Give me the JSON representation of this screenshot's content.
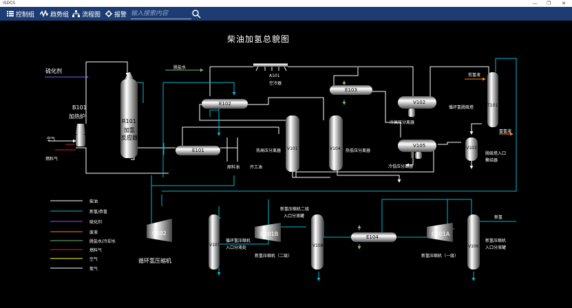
{
  "window": {
    "app_name": "iSDCS",
    "minimize": "—",
    "maximize": "❐",
    "close": "✕"
  },
  "toolbar": {
    "items": [
      {
        "label": "控制组",
        "icon": "list-icon"
      },
      {
        "label": "趋势组",
        "icon": "trend-icon"
      },
      {
        "label": "流程图",
        "icon": "flowchart-icon"
      },
      {
        "label": "报警",
        "icon": "alarm-gear-icon"
      }
    ],
    "search_placeholder": "输入搜索内容"
  },
  "page_title": "柴油加氢总貌图",
  "colors": {
    "toolbar": "#1d3c71",
    "diesel": "#ffffff",
    "hydrogen": "#00bcd4",
    "sulfide": "#8a5cf6",
    "waste_hydrogen": "#ff8800",
    "desalted_water": "#70c070",
    "fuel_gas": "#e02020",
    "air": "#ffff33",
    "nitrogen": "#ffffff"
  },
  "labels": {
    "sulfide_agent": "硫化剂",
    "b101_code": "B101",
    "b101_name": "加热炉",
    "air": "空气",
    "fuel_gas": "燃料气",
    "desalted_water": "脱盐水",
    "a101_code": "A101",
    "a101_name": "空冷器",
    "r101_code": "R101",
    "r101_name1": "加氢",
    "r101_name2": "反应器",
    "e102": "E102",
    "e101": "E101",
    "e103": "E103",
    "e104": "E104",
    "v101": "V101",
    "v104": "V104",
    "v102": "V102",
    "v105": "V105",
    "v103": "V103",
    "v107": "V107",
    "v108": "V108",
    "v106": "V106",
    "t101": "T101",
    "c102": "C102",
    "c101b": "C101B",
    "c101a": "C101A",
    "raw_oil": "原料油",
    "start_oil": "开工油",
    "hot_hp_sep": "热高压分离器",
    "hot_lp_sep": "热低压分离器",
    "cold_hp_sep": "冷高压分离器",
    "cold_lp_sep": "冷低压分离器",
    "lean_hydrogen": "贫氢液",
    "rich_hydrogen": "富氢液",
    "recycle_desulf": "循环氢脱硫塔",
    "desulf_inlet1": "脱硫塔入口",
    "desulf_inlet2": "聚结器",
    "recycle_compressor": "循环氢压缩机",
    "v107_name1": "循环氢压缩机",
    "v107_name2": "入口分液处",
    "c101b_name": "新氢压缩机（二级）",
    "v108_name1": "新氢压缩机二级",
    "v108_name2": "入口分液罐",
    "c101a_name": "新氢压缩机（一级）",
    "new_hydrogen": "新氢",
    "v106_name1": "新氢压缩机",
    "v106_name2": "入口分液罐"
  },
  "legend": [
    {
      "label": "柴油",
      "color": "#ffffff"
    },
    {
      "label": "新氢/恭氢",
      "color": "#00bcd4"
    },
    {
      "label": "硫化剂",
      "color": "#8a5cf6"
    },
    {
      "label": "废液",
      "color": "#ff8800"
    },
    {
      "label": "脱盐水/冷却水",
      "color": "#70c070"
    },
    {
      "label": "燃料气",
      "color": "#e02020"
    },
    {
      "label": "空气",
      "color": "#ffff33"
    },
    {
      "label": "氮气",
      "color": "#ffffff"
    }
  ]
}
